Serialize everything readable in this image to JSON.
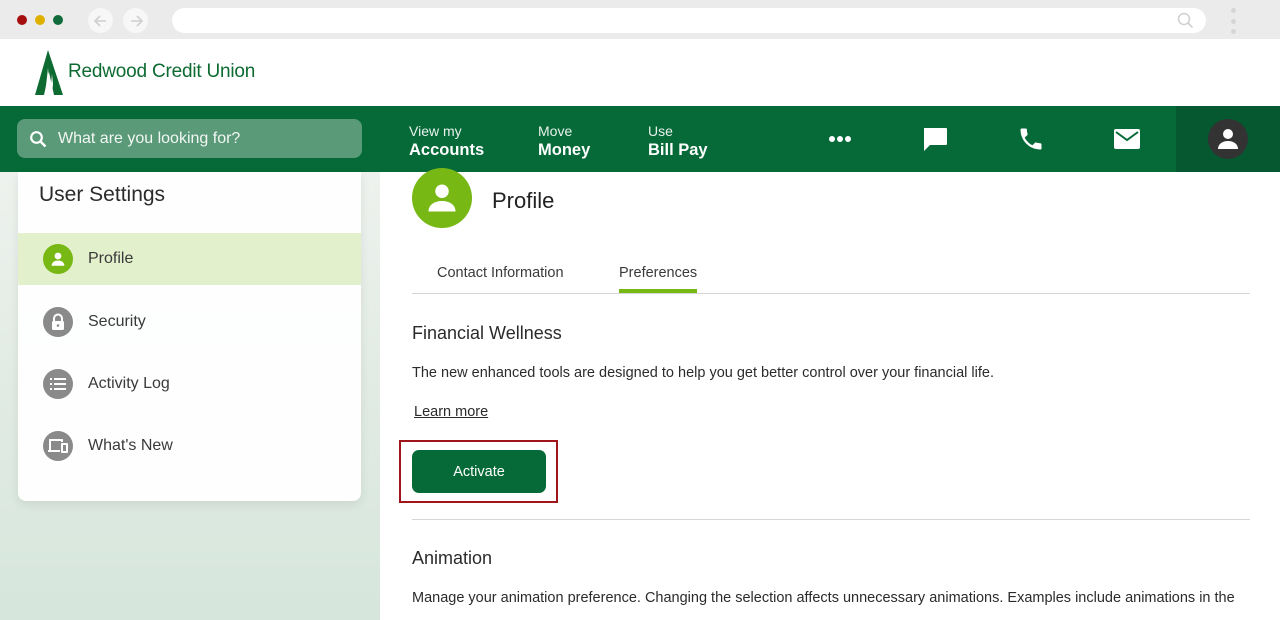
{
  "browser": {
    "url": ""
  },
  "logo": {
    "text": "Redwood Credit Union"
  },
  "topnav": {
    "search_placeholder": "What are you looking for?",
    "links": [
      {
        "small": "View my",
        "big": "Accounts"
      },
      {
        "small": "Move",
        "big": "Money"
      },
      {
        "small": "Use",
        "big": "Bill Pay"
      }
    ],
    "icons": [
      "more-icon",
      "chat-icon",
      "phone-icon",
      "mail-icon",
      "user-avatar-icon"
    ]
  },
  "sidebar": {
    "title": "User Settings",
    "items": [
      {
        "label": "Profile",
        "icon": "profile-icon",
        "active": true
      },
      {
        "label": "Security",
        "icon": "lock-icon",
        "active": false
      },
      {
        "label": "Activity Log",
        "icon": "list-icon",
        "active": false
      },
      {
        "label": "What's New",
        "icon": "devices-icon",
        "active": false
      }
    ]
  },
  "main": {
    "title": "Profile",
    "tabs": [
      {
        "label": "Contact Information",
        "active": false
      },
      {
        "label": "Preferences",
        "active": true
      }
    ],
    "financial_wellness": {
      "title": "Financial Wellness",
      "description": "The new enhanced tools are designed to help you get better control over your financial life.",
      "learn_more": "Learn more",
      "button": "Activate"
    },
    "animation": {
      "title": "Animation",
      "description": "Manage your animation preference. Changing the selection affects unnecessary animations. Examples include animations in the"
    }
  },
  "colors": {
    "brand_green": "#066a38",
    "accent_lime": "#77b815",
    "highlight_red": "#a0151b"
  }
}
